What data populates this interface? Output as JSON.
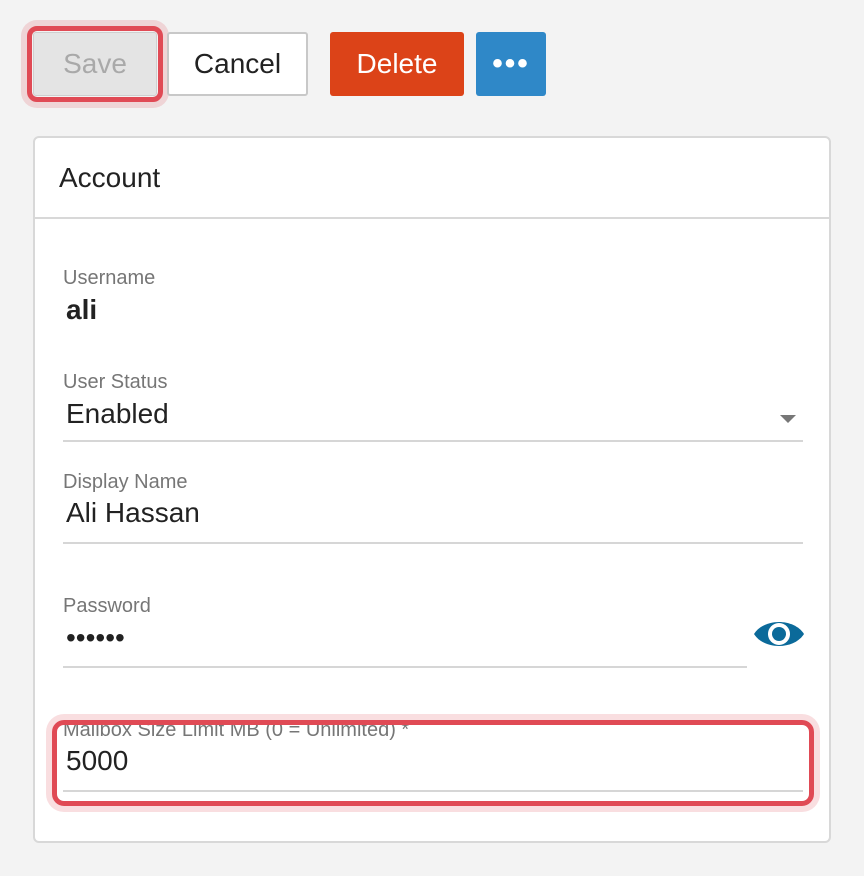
{
  "toolbar": {
    "save_label": "Save",
    "cancel_label": "Cancel",
    "delete_label": "Delete",
    "more_label": "•••"
  },
  "panel": {
    "title": "Account",
    "fields": {
      "username": {
        "label": "Username",
        "value": "ali"
      },
      "user_status": {
        "label": "User Status",
        "value": "Enabled"
      },
      "display_name": {
        "label": "Display Name",
        "value": "Ali Hassan"
      },
      "password": {
        "label": "Password",
        "value": "••••••",
        "toggle_icon": "eye-icon"
      },
      "mailbox_limit": {
        "label": "Mailbox Size Limit MB (0 = Unlimited) *",
        "value": "5000"
      }
    }
  },
  "colors": {
    "delete": "#dc4318",
    "more": "#2f88c8",
    "highlight": "#e04a55",
    "eye": "#0b6a9a"
  }
}
